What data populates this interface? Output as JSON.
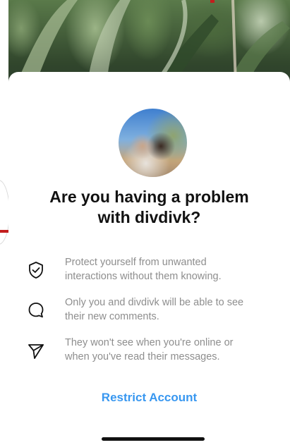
{
  "dialog": {
    "title_line1": "Are you having a problem",
    "title_line2": "with divdivk?",
    "features": [
      {
        "icon": "shield-check-icon",
        "line1": "Protect yourself from unwanted",
        "line2": "interactions without them knowing."
      },
      {
        "icon": "comment-bubble-icon",
        "line1": "Only you and divdivk will be able to see",
        "line2": "their new comments."
      },
      {
        "icon": "paper-plane-icon",
        "line1": "They won't see when you're online or",
        "line2": "when you've read their messages."
      }
    ],
    "action_label": "Restrict Account"
  },
  "colors": {
    "accent": "#3897f0",
    "title": "#111111",
    "body_text": "#8e8e8e",
    "edge_marker": "#c21d1d"
  }
}
